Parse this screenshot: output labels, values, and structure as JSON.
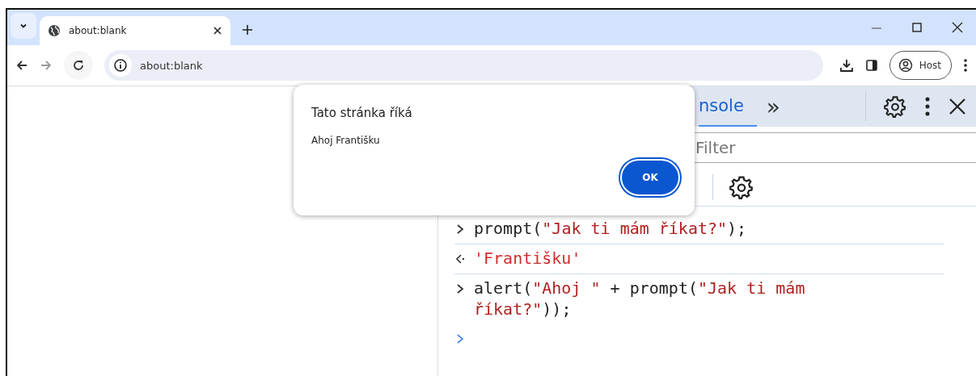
{
  "tabs": [
    {
      "label": "about:blank",
      "selected": true
    }
  ],
  "address_bar": {
    "value": "about:blank"
  },
  "profile": {
    "label": "Host"
  },
  "devtools": {
    "tabs": [
      {
        "label": "nsole",
        "selected": true
      }
    ],
    "more": "»",
    "filter": {
      "placeholder": "Filter"
    },
    "lines": [
      {
        "kind": "input",
        "tokens": [
          {
            "kind": "code",
            "text": "prompt("
          },
          {
            "kind": "string",
            "text": "\"Jak ti mám říkat?\""
          },
          {
            "kind": "code",
            "text": ");"
          }
        ]
      },
      {
        "kind": "output",
        "tokens": [
          {
            "kind": "result",
            "text": "'Františku'"
          }
        ]
      },
      {
        "kind": "input",
        "tokens": [
          {
            "kind": "code",
            "text": "alert("
          },
          {
            "kind": "string",
            "text": "\"Ahoj \""
          },
          {
            "kind": "code",
            "text": " + prompt("
          },
          {
            "kind": "string",
            "text": "\"Jak ti mám říkat?\""
          },
          {
            "kind": "code",
            "text": "));"
          }
        ]
      },
      {
        "kind": "prompt"
      }
    ]
  },
  "dialog": {
    "title": "Tato stránka říká",
    "message": "Ahoj Františku",
    "button": "OK"
  }
}
